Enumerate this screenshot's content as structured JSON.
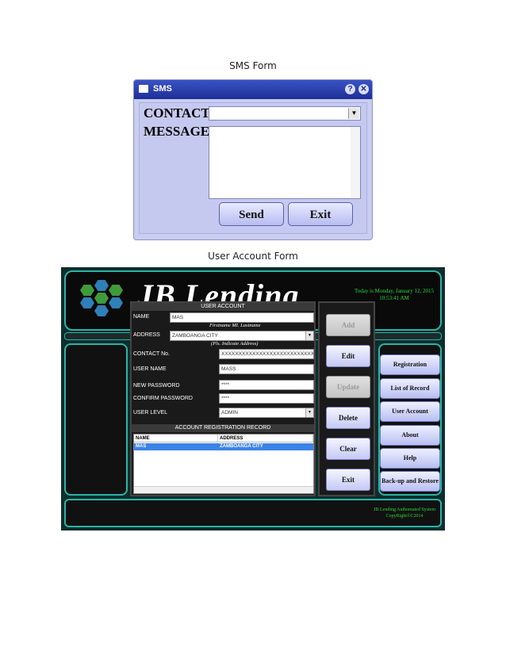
{
  "captions": {
    "sms": "SMS Form",
    "user_account": "User Account Form"
  },
  "sms_form": {
    "title": "SMS",
    "contact_label": "CONTACT",
    "message_label": "MESSAGE",
    "contact_value": "",
    "message_value": "",
    "send_label": "Send",
    "exit_label": "Exit",
    "help_glyph": "?",
    "close_glyph": "✕",
    "dropdown_glyph": "▼"
  },
  "user_account_form": {
    "logo_text": "JB Lending",
    "today_line1": "Today is  Monday, January 12, 2015",
    "today_line2": "10:53:41 AM",
    "section_title": "USER ACCOUNT",
    "name_label": "NAME",
    "name_value": "MAS",
    "name_hint": "Firstname MI. Lastname",
    "address_label": "ADDRESS",
    "address_value": "ZAMBOANGA CITY",
    "address_hint": "(Pls. Indicate Address)",
    "contact_label": "CONTACT No.",
    "contact_value": "XXXXXXXXXXXXXXXXXXXXXXXXXXXXX",
    "username_label": "USER NAME",
    "username_value": "MASS",
    "new_password_label": "NEW PASSWORD",
    "new_password_value": "****",
    "confirm_password_label": "CONFIRM PASSWORD",
    "confirm_password_value": "****",
    "user_level_label": "USER LEVEL",
    "user_level_value": "ADMIN",
    "record_title": "ACCOUNT REGISTRATION RECORD",
    "record_columns": [
      "NAME",
      "ADDRESS"
    ],
    "record_rows": [
      {
        "name": "MAS",
        "address": "ZAMBOANGA CITY"
      }
    ],
    "actions": {
      "add": "Add",
      "edit": "Edit",
      "update": "Update",
      "delete": "Delete",
      "clear": "Clear",
      "exit": "Exit"
    },
    "nav": [
      "Registration",
      "List of Record",
      "User Account",
      "About",
      "Help",
      "Back-up and Restore"
    ],
    "footer_line1": "JB Lending Authomated System",
    "footer_line2": "CopyRight©C2014",
    "colors": {
      "accent_teal": "#2bb3a6",
      "clock_green": "#2bd83b",
      "selection_blue": "#3c83e8"
    }
  }
}
